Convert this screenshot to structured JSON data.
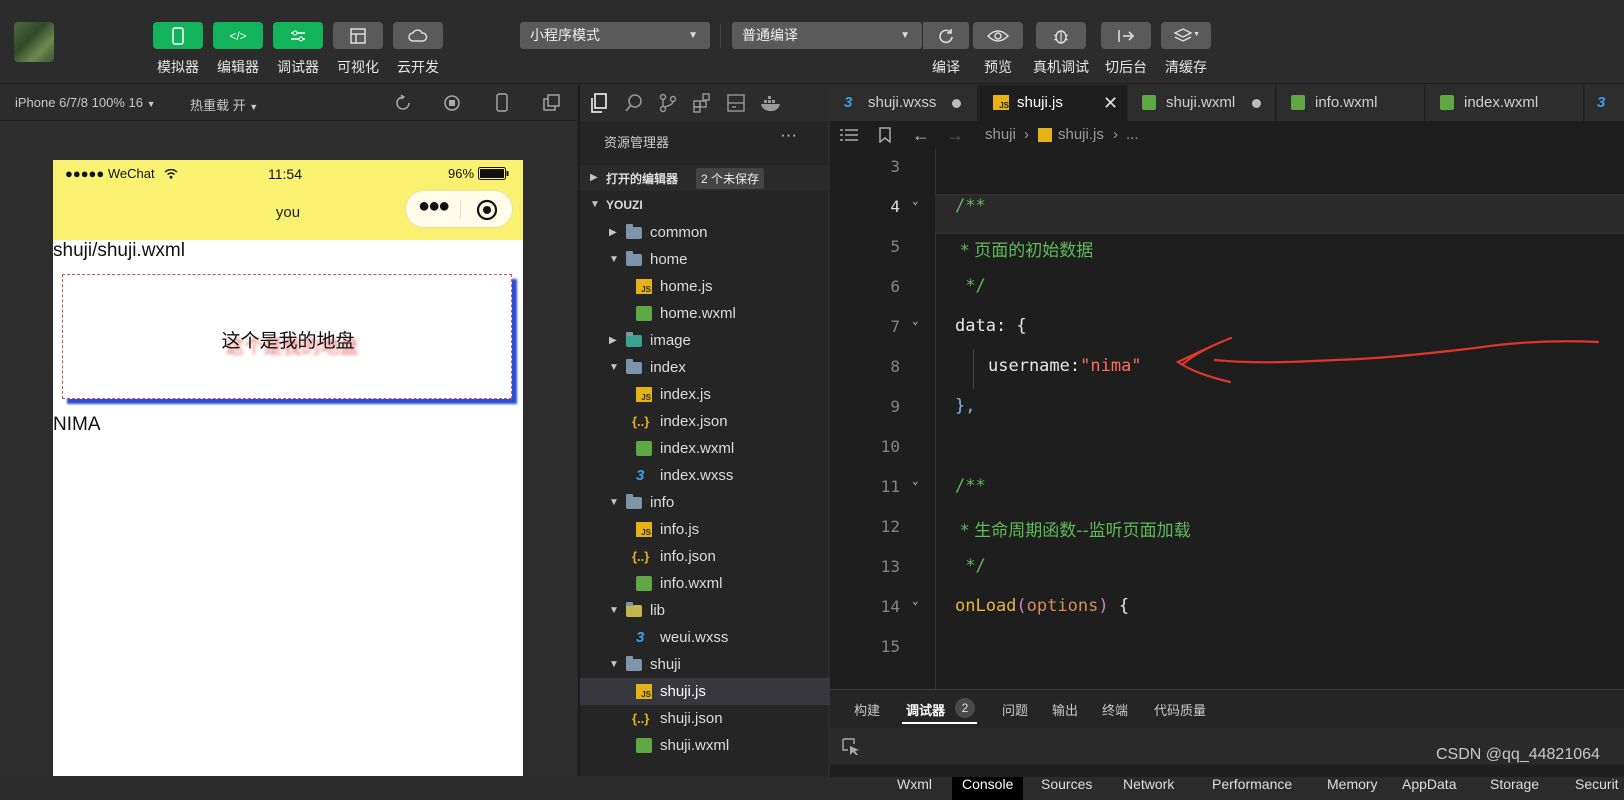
{
  "toolbar": {
    "buttons": [
      {
        "label": "模拟器"
      },
      {
        "label": "编辑器"
      },
      {
        "label": "调试器"
      },
      {
        "label": "可视化"
      },
      {
        "label": "云开发"
      }
    ],
    "mode_select": "小程序模式",
    "compile_select": "普通编译",
    "right_buttons": [
      {
        "label": "编译"
      },
      {
        "label": "预览"
      },
      {
        "label": "真机调试"
      },
      {
        "label": "切后台"
      },
      {
        "label": "清缓存"
      }
    ]
  },
  "simulator": {
    "device": "iPhone 6/7/8 100% 16",
    "hot_reload": "热重载 开",
    "status": {
      "carrier": "●●●●● WeChat",
      "time": "11:54",
      "battery": "96%"
    },
    "nav_title": "you",
    "page_path": "shuji/shuji.wxml",
    "box_text": "这个是我的地盘",
    "data_text": "NIMA"
  },
  "explorer": {
    "title": "资源管理器",
    "open_editors": "打开的编辑器",
    "unsaved": "2 个未保存",
    "project": "YOUZI",
    "tree": [
      {
        "name": "common"
      },
      {
        "name": "home"
      },
      {
        "name": "home.js"
      },
      {
        "name": "home.wxml"
      },
      {
        "name": "image"
      },
      {
        "name": "index"
      },
      {
        "name": "index.js"
      },
      {
        "name": "index.json"
      },
      {
        "name": "index.wxml"
      },
      {
        "name": "index.wxss"
      },
      {
        "name": "info"
      },
      {
        "name": "info.js"
      },
      {
        "name": "info.json"
      },
      {
        "name": "info.wxml"
      },
      {
        "name": "lib"
      },
      {
        "name": "weui.wxss"
      },
      {
        "name": "shuji"
      },
      {
        "name": "shuji.js"
      },
      {
        "name": "shuji.json"
      },
      {
        "name": "shuji.wxml"
      }
    ]
  },
  "editor": {
    "tabs": [
      {
        "label": "shuji.wxss"
      },
      {
        "label": "shuji.js"
      },
      {
        "label": "shuji.wxml"
      },
      {
        "label": "info.wxml"
      },
      {
        "label": "index.wxml"
      }
    ],
    "breadcrumb": {
      "folder": "shuji",
      "file": "shuji.js",
      "more": "..."
    },
    "lines": [
      {
        "n": "3",
        "text": ""
      },
      {
        "n": "4",
        "text": "/**"
      },
      {
        "n": "5",
        "text": " * 页面的初始数据"
      },
      {
        "n": "6",
        "text": " */"
      },
      {
        "n": "7",
        "text": "data: {"
      },
      {
        "n": "8",
        "text": "username:\"nima\""
      },
      {
        "n": "9",
        "text": "},"
      },
      {
        "n": "10",
        "text": ""
      },
      {
        "n": "11",
        "text": "/**"
      },
      {
        "n": "12",
        "text": " * 生命周期函数--监听页面加载"
      },
      {
        "n": "13",
        "text": " */"
      },
      {
        "n": "14",
        "text": "onLoad(options) {"
      },
      {
        "n": "15",
        "text": ""
      }
    ]
  },
  "panel": {
    "top_tabs": [
      {
        "label": "构建"
      },
      {
        "label": "调试器"
      },
      {
        "label": "问题"
      },
      {
        "label": "输出"
      },
      {
        "label": "终端"
      },
      {
        "label": "代码质量"
      }
    ],
    "debugger_badge": "2",
    "devtools_tabs": [
      {
        "label": "Wxml"
      },
      {
        "label": "Console"
      },
      {
        "label": "Sources"
      },
      {
        "label": "Network"
      },
      {
        "label": "Performance"
      },
      {
        "label": "Memory"
      },
      {
        "label": "AppData"
      },
      {
        "label": "Storage"
      },
      {
        "label": "Securit"
      }
    ]
  },
  "watermark": "CSDN @qq_44821064",
  "colors": {
    "accent_green": "#13b35b",
    "nav_yellow": "#fbf171",
    "annotation_red": "#e2362b"
  }
}
